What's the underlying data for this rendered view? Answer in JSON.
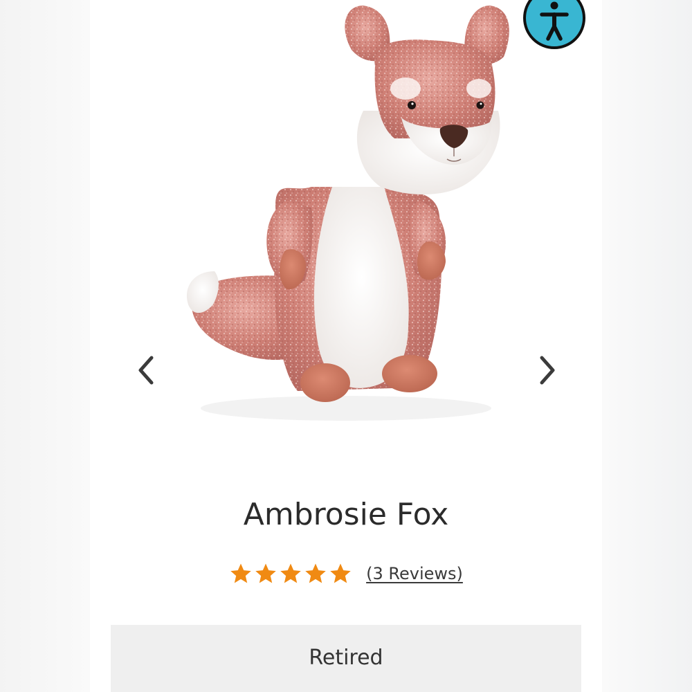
{
  "colors": {
    "star": "#f08a13",
    "accessibility_bg": "#39b6d2",
    "status_bg": "#efefef",
    "title": "#2b2b2b"
  },
  "gallery": {
    "product_image_icon": "plush-fox-image",
    "prev_icon": "chevron-left-icon",
    "next_icon": "chevron-right-icon"
  },
  "accessibility": {
    "icon": "accessibility-person-icon"
  },
  "product": {
    "title": "Ambrosie Fox",
    "rating": 5,
    "rating_max": 5,
    "reviews_label": "(3 Reviews)",
    "status": "Retired"
  }
}
